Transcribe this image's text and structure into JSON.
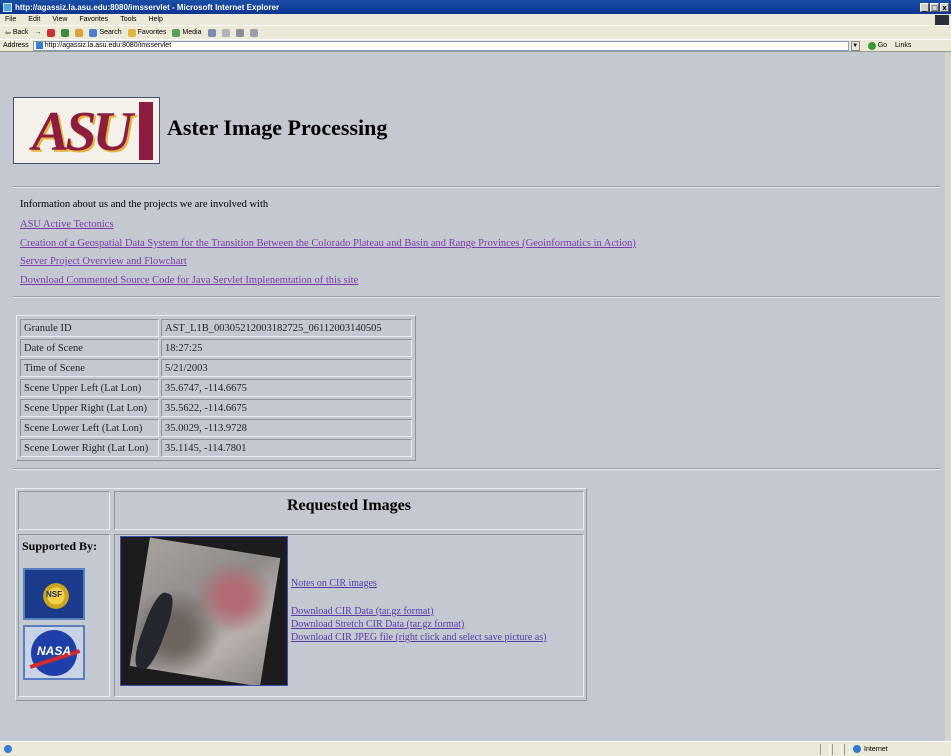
{
  "window": {
    "title": "http://agassiz.la.asu.edu:8080/imsservlet - Microsoft Internet Explorer",
    "minimize": "_",
    "maximize": "□",
    "close": "x"
  },
  "menu": [
    "File",
    "Edit",
    "View",
    "Favorites",
    "Tools",
    "Help"
  ],
  "toolbar": {
    "back": "Back",
    "search": "Search",
    "favorites": "Favorites",
    "media": "Media"
  },
  "address": {
    "label": "Address",
    "url": "http://agassiz.la.asu.edu:8080/imsservlet",
    "go": "Go",
    "links": "Links"
  },
  "header": {
    "logo_text": "ASU",
    "title": "Aster Image Processing"
  },
  "info": {
    "text": "Information about us and the projects we are involved with",
    "links": [
      "ASU Active Tectonics",
      "Creation of a Geospatial Data System for the Transition Between the Colorado Plateau and Basin and Range Provinces (Geoinformatics in Action)",
      "Server Project Overview and Flowchart",
      "Download Commented Source Code for Java Servlet Implenemtation of this site"
    ]
  },
  "granule_table": [
    {
      "key": "Granule ID",
      "value": "AST_L1B_00305212003182725_06112003140505"
    },
    {
      "key": "Date of Scene",
      "value": "18:27:25"
    },
    {
      "key": "Time of Scene",
      "value": "5/21/2003"
    },
    {
      "key": "Scene Upper Left (Lat Lon)",
      "value": "35.6747, -114.6675"
    },
    {
      "key": "Scene Upper Right (Lat Lon)",
      "value": "35.5622, -114.6675"
    },
    {
      "key": "Scene Lower Left (Lat Lon)",
      "value": "35.0029, -113.9728"
    },
    {
      "key": "Scene Lower Right (Lat Lon)",
      "value": "35.1145, -114.7801"
    }
  ],
  "lower": {
    "requested_title": "Requested Images",
    "supported_by": "Supported By:",
    "nsf_text": "NSF",
    "nasa_text": "NASA",
    "cir_note": "Notes on CIR images",
    "downloads": [
      "Download CIR Data (tar.gz format)",
      "Download Stretch CIR Data (tar.gz format)",
      "Download CIR JPEG file (right click and select save picture as)"
    ]
  },
  "status": {
    "zone": "Internet"
  }
}
